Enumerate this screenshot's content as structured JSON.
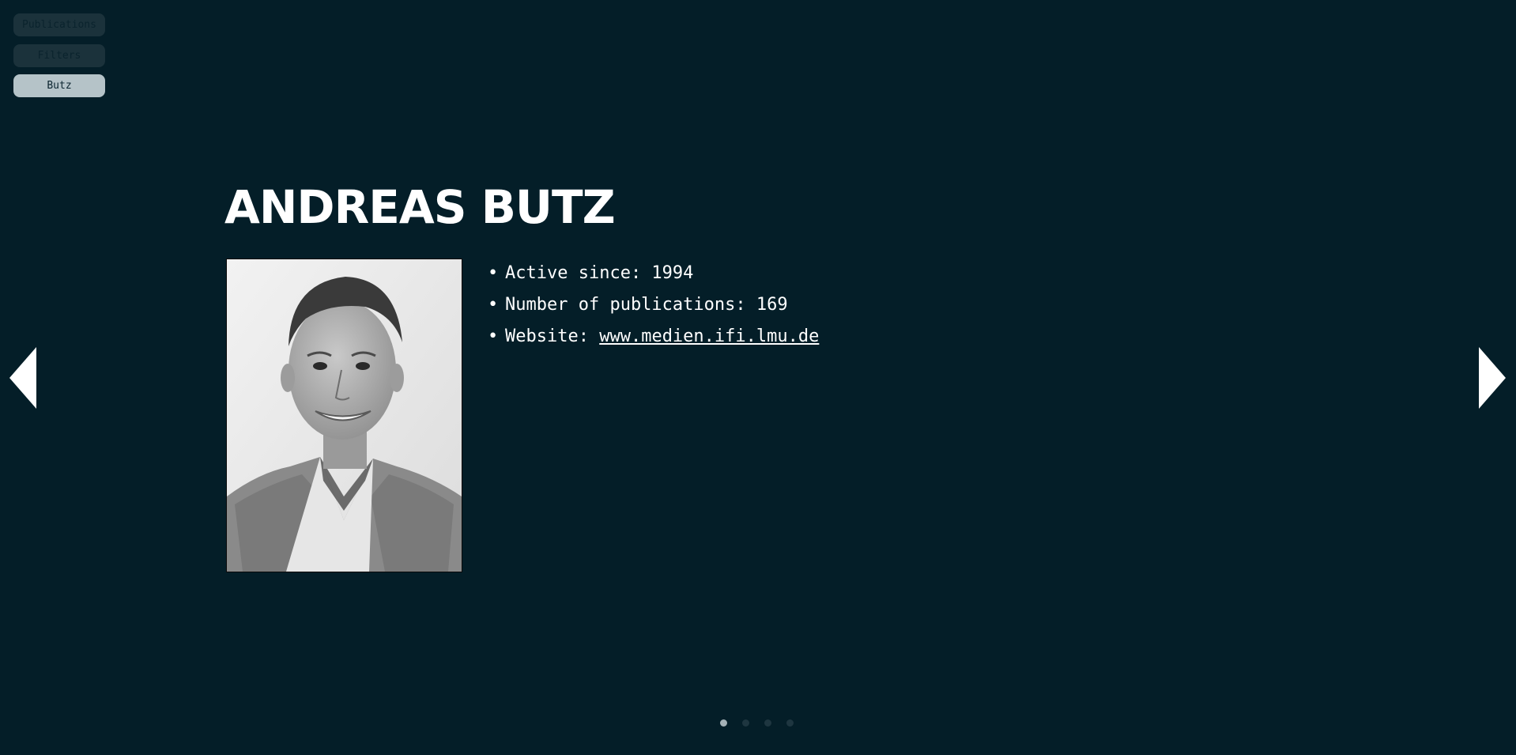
{
  "nav": {
    "tabs": [
      {
        "label": "Publications",
        "active": false
      },
      {
        "label": "Filters",
        "active": false
      },
      {
        "label": "Butz",
        "active": true
      }
    ]
  },
  "profile": {
    "name": "ANDREAS BUTZ",
    "bullet": "•",
    "active_since_label": "Active since: 1994",
    "publications_label": "Number of publications: 169",
    "website_label": "Website: ",
    "website_link": "www.medien.ifi.lmu.de"
  },
  "carousel": {
    "prev_icon": "triangle-left-icon",
    "next_icon": "triangle-right-icon",
    "pages": 4,
    "current_page": 1
  },
  "colors": {
    "background": "#041e28",
    "active_tab": "#b5c3c8",
    "inactive_tab": "#1b323b",
    "text": "#ffffff"
  }
}
